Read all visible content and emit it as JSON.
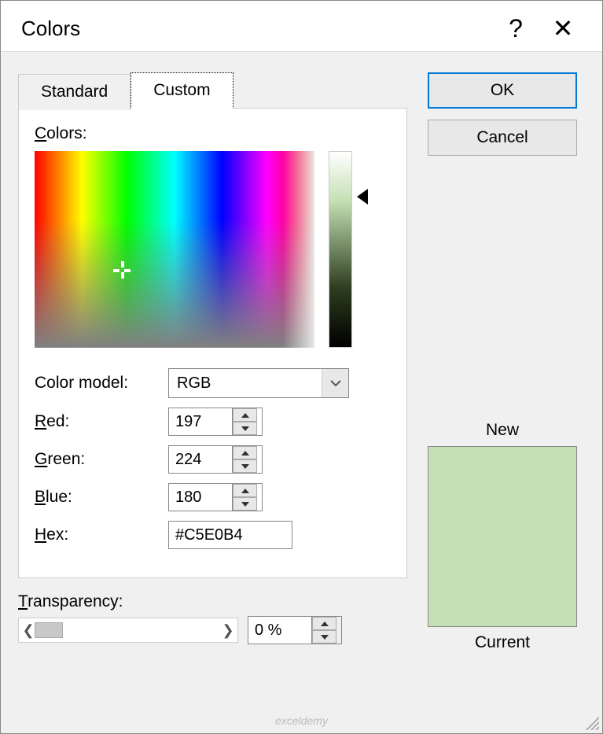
{
  "titlebar": {
    "title": "Colors",
    "help_label": "?",
    "close_label": "✕"
  },
  "tabs": {
    "standard": "Standard",
    "custom": "Custom"
  },
  "panel": {
    "colors_label_pre": "C",
    "colors_label_rest": "olors:"
  },
  "form": {
    "model_label": "Color model:",
    "model_value": "RGB",
    "red_pre": "R",
    "red_rest": "ed:",
    "red_value": "197",
    "green_pre": "G",
    "green_rest": "reen:",
    "green_value": "224",
    "blue_pre": "B",
    "blue_rest": "lue:",
    "blue_value": "180",
    "hex_pre": "H",
    "hex_rest": "ex:",
    "hex_value": "#C5E0B4"
  },
  "buttons": {
    "ok": "OK",
    "cancel": "Cancel"
  },
  "preview": {
    "new_label": "New",
    "current_label": "Current",
    "new_color": "#C5E0B4"
  },
  "transparency": {
    "label_pre": "T",
    "label_rest": "ransparency:",
    "value": "0 %"
  },
  "watermark": "exceldemy"
}
